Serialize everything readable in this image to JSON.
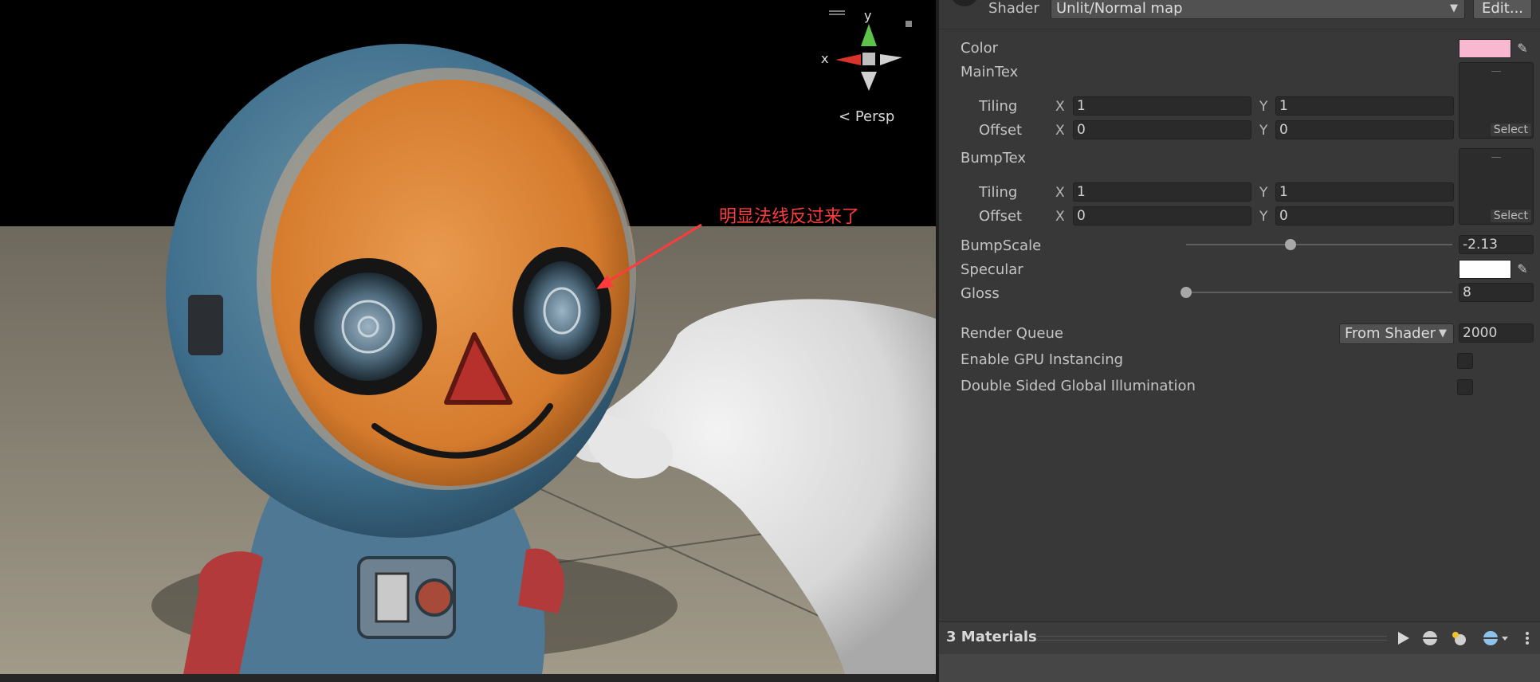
{
  "scene": {
    "gizmo": {
      "y_label": "y",
      "x_label": "x",
      "persp_label": "Persp"
    },
    "annotation": "明显法线反过来了",
    "annotation_color": "#ff3b3b"
  },
  "inspector": {
    "shader_label": "Shader",
    "shader_value": "Unlit/Normal map",
    "edit_button": "Edit...",
    "color": {
      "label": "Color",
      "value": "#f8b8d0"
    },
    "main_tex": {
      "label": "MainTex",
      "tiling_label": "Tiling",
      "offset_label": "Offset",
      "tiling_x": "1",
      "tiling_y": "1",
      "offset_x": "0",
      "offset_y": "0",
      "select_label": "Select"
    },
    "bump_tex": {
      "label": "BumpTex",
      "tiling_label": "Tiling",
      "offset_label": "Offset",
      "tiling_x": "1",
      "tiling_y": "1",
      "offset_x": "0",
      "offset_y": "0",
      "select_label": "Select"
    },
    "axis_x": "X",
    "axis_y": "Y",
    "bump_scale": {
      "label": "BumpScale",
      "value": "-2.13",
      "min": -10,
      "max": 10,
      "current": -2.13
    },
    "specular": {
      "label": "Specular",
      "value": "#ffffff"
    },
    "gloss": {
      "label": "Gloss",
      "value": "8",
      "min": 8,
      "max": 256,
      "current": 8
    },
    "render_queue": {
      "label": "Render Queue",
      "mode": "From Shader",
      "value": "2000"
    },
    "gpu_instancing": {
      "label": "Enable GPU Instancing",
      "checked": false
    },
    "double_sided_gi": {
      "label": "Double Sided Global Illumination",
      "checked": false
    }
  },
  "footer": {
    "materials_label": "3 Materials",
    "play_icon": "play-icon",
    "sphere_icon": "sphere-preview-icon",
    "light_icon": "light-icon",
    "env_icon": "environment-icon",
    "more_icon": "kebab-menu-icon"
  }
}
